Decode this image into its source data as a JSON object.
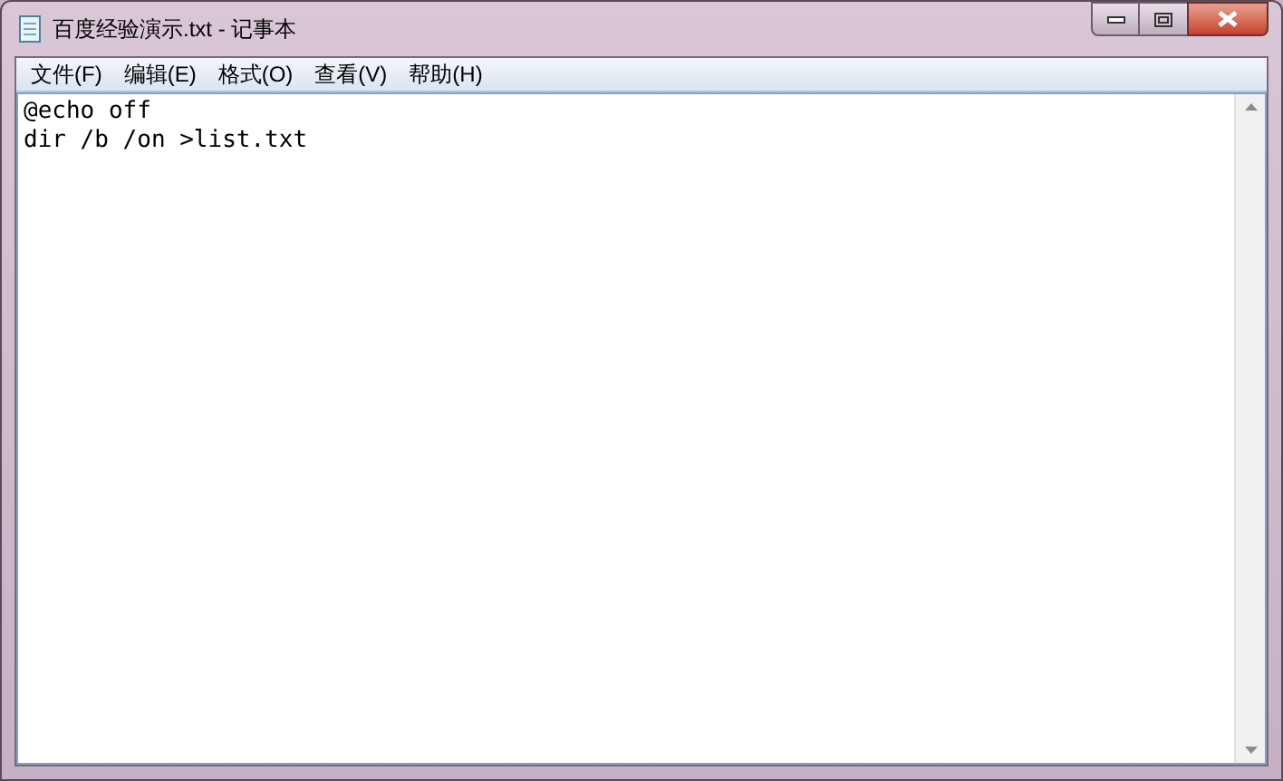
{
  "window": {
    "title": "百度经验演示.txt - 记事本"
  },
  "menu": [
    "文件(F)",
    "编辑(E)",
    "格式(O)",
    "查看(V)",
    "帮助(H)"
  ],
  "document": {
    "lines": [
      "@echo off",
      "dir /b /on >list.txt"
    ]
  }
}
